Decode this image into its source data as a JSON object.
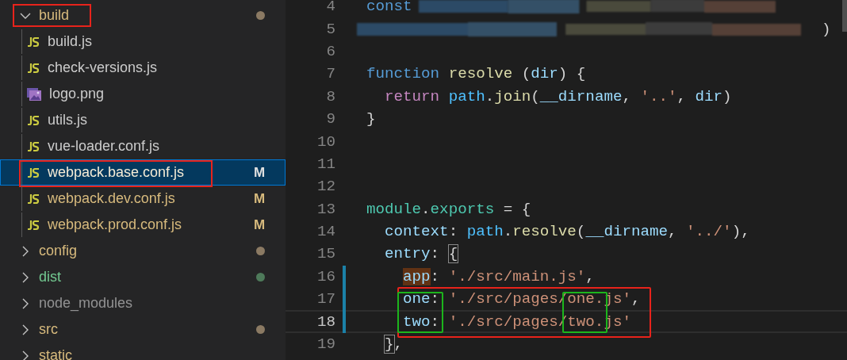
{
  "sidebar": {
    "items": [
      {
        "label": "build",
        "kind": "folder",
        "expanded": true,
        "selected": false,
        "annotated": true,
        "modified": true,
        "untracked": false,
        "ignored": false,
        "color": "#8b7a63",
        "children": [
          {
            "label": "build.js",
            "kind": "js",
            "selected": false,
            "annotated": false,
            "modified": false,
            "untracked": false,
            "ignored": false
          },
          {
            "label": "check-versions.js",
            "kind": "js",
            "selected": false,
            "annotated": false,
            "modified": false,
            "untracked": false,
            "ignored": false
          },
          {
            "label": "logo.png",
            "kind": "image",
            "selected": false,
            "annotated": false,
            "modified": false,
            "untracked": false,
            "ignored": false
          },
          {
            "label": "utils.js",
            "kind": "js",
            "selected": false,
            "annotated": false,
            "modified": false,
            "untracked": false,
            "ignored": false
          },
          {
            "label": "vue-loader.conf.js",
            "kind": "js",
            "selected": false,
            "annotated": false,
            "modified": false,
            "untracked": false,
            "ignored": false
          },
          {
            "label": "webpack.base.conf.js",
            "kind": "js",
            "selected": true,
            "annotated": true,
            "modified": true,
            "untracked": false,
            "ignored": false,
            "badge": "M"
          },
          {
            "label": "webpack.dev.conf.js",
            "kind": "js",
            "selected": false,
            "annotated": false,
            "modified": true,
            "untracked": false,
            "ignored": false,
            "badge": "M"
          },
          {
            "label": "webpack.prod.conf.js",
            "kind": "js",
            "selected": false,
            "annotated": false,
            "modified": true,
            "untracked": false,
            "ignored": false,
            "badge": "M"
          }
        ]
      },
      {
        "label": "config",
        "kind": "folder",
        "expanded": false,
        "selected": false,
        "annotated": false,
        "modified": true,
        "untracked": false,
        "ignored": false,
        "color": "#8b7a63"
      },
      {
        "label": "dist",
        "kind": "folder",
        "expanded": false,
        "selected": false,
        "annotated": false,
        "modified": false,
        "untracked": true,
        "ignored": false,
        "color": "#4e7a5a"
      },
      {
        "label": "node_modules",
        "kind": "folder",
        "expanded": false,
        "selected": false,
        "annotated": false,
        "modified": false,
        "untracked": false,
        "ignored": true
      },
      {
        "label": "src",
        "kind": "folder",
        "expanded": false,
        "selected": false,
        "annotated": false,
        "modified": true,
        "untracked": false,
        "ignored": false,
        "color": "#8b7a63"
      },
      {
        "label": "static",
        "kind": "folder",
        "expanded": false,
        "selected": false,
        "annotated": false,
        "modified": true,
        "untracked": false,
        "ignored": false
      }
    ]
  },
  "editor": {
    "lines": [
      {
        "number": "4",
        "current": false,
        "changed": false,
        "tokens": [
          {
            "text": "const",
            "kind": "keyword"
          },
          {
            "kind": "redacted"
          }
        ]
      },
      {
        "number": "5",
        "current": false,
        "changed": false,
        "tokens": [
          {
            "kind": "redacted"
          },
          {
            "text": ")",
            "kind": "punct"
          }
        ]
      },
      {
        "number": "6",
        "current": false,
        "changed": false
      },
      {
        "number": "7",
        "current": false,
        "changed": false,
        "tokens": [
          {
            "text": "function ",
            "kind": "keyword"
          },
          {
            "text": "resolve",
            "kind": "function"
          },
          {
            "text": " (",
            "kind": "punct"
          },
          {
            "text": "dir",
            "kind": "param"
          },
          {
            "text": ") {",
            "kind": "punct"
          }
        ]
      },
      {
        "number": "8",
        "current": false,
        "changed": false,
        "tokens": [
          {
            "text": "  return ",
            "kind": "control"
          },
          {
            "text": "path",
            "kind": "variable"
          },
          {
            "text": ".",
            "kind": "punct"
          },
          {
            "text": "join",
            "kind": "function"
          },
          {
            "text": "(",
            "kind": "punct"
          },
          {
            "text": "__dirname",
            "kind": "param"
          },
          {
            "text": ", ",
            "kind": "punct"
          },
          {
            "text": "'..'",
            "kind": "string"
          },
          {
            "text": ", ",
            "kind": "punct"
          },
          {
            "text": "dir",
            "kind": "param"
          },
          {
            "text": ")",
            "kind": "punct"
          }
        ]
      },
      {
        "number": "9",
        "current": false,
        "changed": false,
        "tokens": [
          {
            "text": "}",
            "kind": "punct"
          }
        ]
      },
      {
        "number": "10",
        "current": false,
        "changed": false
      },
      {
        "number": "11",
        "current": false,
        "changed": false
      },
      {
        "number": "12",
        "current": false,
        "changed": false
      },
      {
        "number": "13",
        "current": false,
        "changed": false,
        "tokens": [
          {
            "text": "module",
            "kind": "module"
          },
          {
            "text": ".",
            "kind": "punct"
          },
          {
            "text": "exports",
            "kind": "module"
          },
          {
            "text": " = {",
            "kind": "punct"
          }
        ]
      },
      {
        "number": "14",
        "current": false,
        "changed": false,
        "tokens": [
          {
            "text": "  context",
            "kind": "param"
          },
          {
            "text": ": ",
            "kind": "punct"
          },
          {
            "text": "path",
            "kind": "variable"
          },
          {
            "text": ".",
            "kind": "punct"
          },
          {
            "text": "resolve",
            "kind": "function"
          },
          {
            "text": "(",
            "kind": "punct"
          },
          {
            "text": "__dirname",
            "kind": "param"
          },
          {
            "text": ", ",
            "kind": "punct"
          },
          {
            "text": "'../'",
            "kind": "string"
          },
          {
            "text": "),",
            "kind": "punct"
          }
        ]
      },
      {
        "number": "15",
        "current": false,
        "changed": false,
        "tokens": [
          {
            "text": "  entry",
            "kind": "param"
          },
          {
            "text": ": ",
            "kind": "punct"
          },
          {
            "text": "{",
            "kind": "bracket"
          }
        ]
      },
      {
        "number": "16",
        "current": false,
        "changed": true,
        "tokens": [
          {
            "text": "    app",
            "kind": "highlight"
          },
          {
            "text": ": ",
            "kind": "punct"
          },
          {
            "text": "'./src/main.js'",
            "kind": "string"
          },
          {
            "text": ",",
            "kind": "punct"
          }
        ]
      },
      {
        "number": "17",
        "current": false,
        "changed": true,
        "tokens": [
          {
            "text": "    one",
            "kind": "param"
          },
          {
            "text": ": ",
            "kind": "punct"
          },
          {
            "text": "'./src/pages/one.js'",
            "kind": "string"
          },
          {
            "text": ",",
            "kind": "punct"
          }
        ]
      },
      {
        "number": "18",
        "current": true,
        "changed": true,
        "tokens": [
          {
            "text": "    two",
            "kind": "param"
          },
          {
            "text": ": ",
            "kind": "punct"
          },
          {
            "text": "'./src/pages/two.js'",
            "kind": "string"
          }
        ]
      },
      {
        "number": "19",
        "current": false,
        "changed": false,
        "tokens": [
          {
            "text": "  }",
            "kind": "bracket"
          },
          {
            "text": ",",
            "kind": "punct"
          }
        ]
      }
    ]
  }
}
